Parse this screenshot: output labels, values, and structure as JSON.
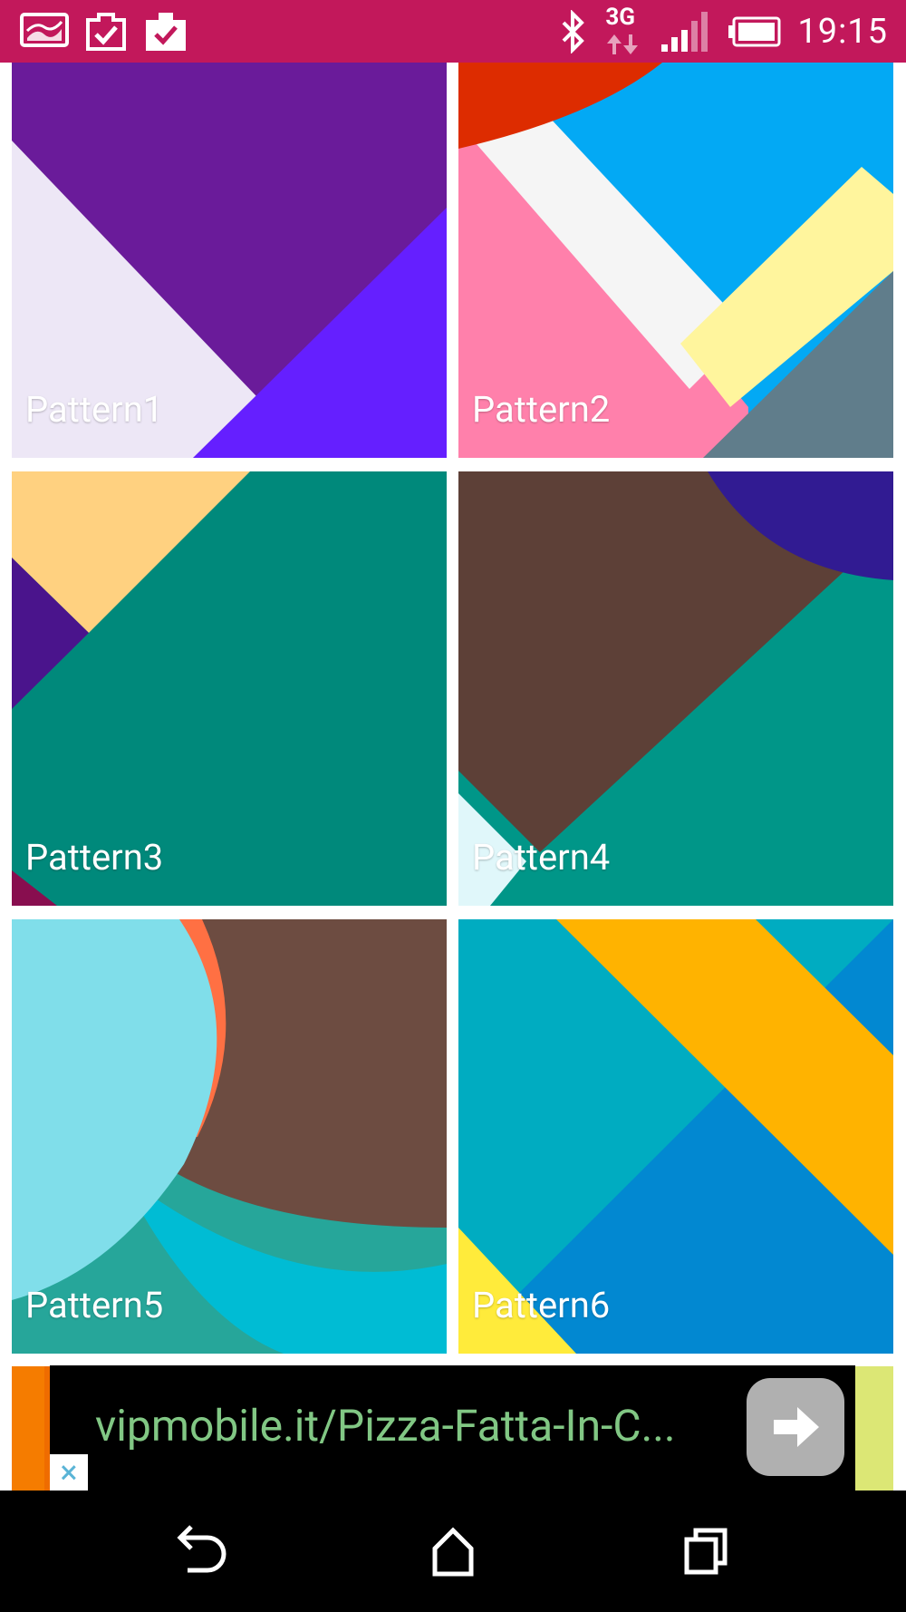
{
  "status_bar": {
    "time": "19:15",
    "network": "3G",
    "icons": [
      "gallery-icon",
      "task-check-icon",
      "briefcase-check-icon",
      "bluetooth-icon",
      "data-arrows-icon",
      "signal-icon",
      "battery-icon"
    ]
  },
  "tiles": [
    {
      "label": "Pattern1"
    },
    {
      "label": "Pattern2"
    },
    {
      "label": "Pattern3"
    },
    {
      "label": "Pattern4"
    },
    {
      "label": "Pattern5"
    },
    {
      "label": "Pattern6"
    }
  ],
  "ad": {
    "url_text": "vipmobile.it/Pizza-Fatta-In-C...",
    "close_symbol": "×",
    "go_icon": "arrow-right-icon"
  },
  "nav": {
    "buttons": [
      "back-icon",
      "home-icon",
      "recents-icon"
    ]
  }
}
